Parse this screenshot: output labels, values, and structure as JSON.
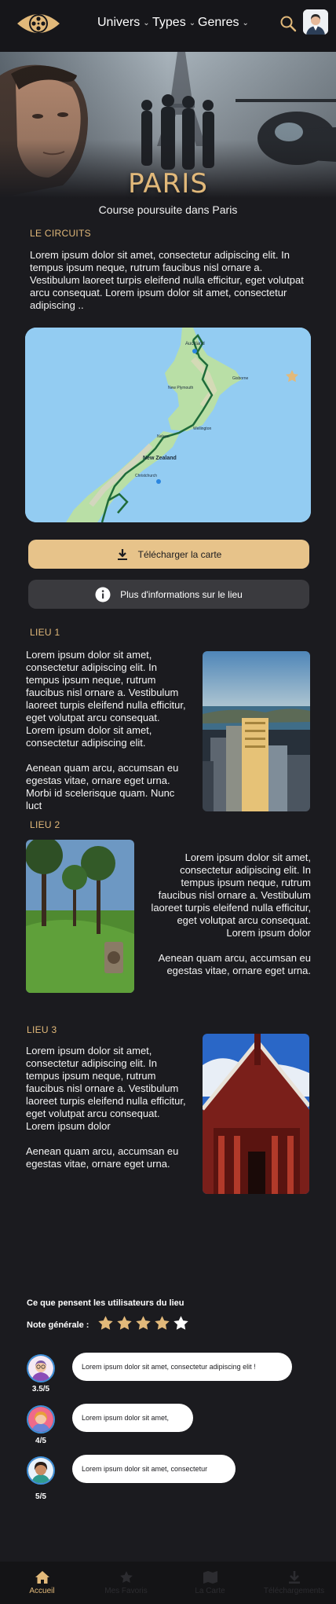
{
  "header": {
    "nav": [
      {
        "label": "Univers"
      },
      {
        "label": "Types"
      },
      {
        "label": "Genres"
      }
    ]
  },
  "hero": {
    "title": "PARIS",
    "subtitle": "Course poursuite dans Paris"
  },
  "circuit": {
    "label": "LE CIRCUITS",
    "text": "Lorem ipsum dolor sit amet, consectetur adipiscing elit. In tempus ipsum neque, rutrum faucibus nisl ornare a. Vestibulum laoreet turpis eleifend nulla efficitur, eget volutpat arcu consequat. Lorem ipsum dolor sit amet, consectetur adipiscing ..",
    "map_labels": [
      "Auckland",
      "New Plymouth",
      "Gisborne",
      "Nelson",
      "Wellington",
      "New Zealand",
      "Christchurch"
    ]
  },
  "buttons": {
    "download": "Télécharger la carte",
    "info": "Plus d'informations sur le lieu"
  },
  "lieux": [
    {
      "label": "LIEU  1",
      "p1": "Lorem ipsum dolor sit amet, consectetur adipiscing elit. In tempus ipsum neque, rutrum faucibus nisl ornare a. Vestibulum laoreet turpis eleifend nulla efficitur, eget volutpat arcu consequat. Lorem ipsum dolor sit amet, consectetur adipiscing elit.",
      "p2": "Aenean quam arcu, accumsan eu egestas vitae, ornare eget urna. Morbi id scelerisque quam. Nunc luct"
    },
    {
      "label": "LIEU 2",
      "p1": "Lorem ipsum dolor sit amet, consectetur adipiscing elit. In tempus ipsum neque, rutrum faucibus nisl ornare a. Vestibulum laoreet turpis eleifend nulla efficitur, eget volutpat arcu consequat. Lorem ipsum dolor",
      "p2": "Aenean quam arcu, accumsan eu egestas vitae, ornare eget urna."
    },
    {
      "label": "LIEU 3",
      "p1": "Lorem ipsum dolor sit amet, consectetur adipiscing elit. In tempus ipsum neque, rutrum faucibus nisl ornare a. Vestibulum laoreet turpis eleifend nulla efficitur, eget volutpat arcu consequat. Lorem ipsum dolor",
      "p2": "Aenean quam arcu, accumsan eu egestas vitae, ornare eget urna."
    }
  ],
  "reviews": {
    "title": "Ce que pensent les utilisateurs du lieu",
    "note_label": "Note générale :",
    "overall_rating": 4,
    "overall_max": 5,
    "items": [
      {
        "score": "3.5/5",
        "text": "Lorem ipsum dolor sit amet, consectetur adipiscing elit !"
      },
      {
        "score": "4/5",
        "text": "Lorem ipsum dolor sit amet,"
      },
      {
        "score": "5/5",
        "text": "Lorem ipsum dolor sit amet, consectetur"
      }
    ]
  },
  "tabbar": [
    {
      "label": "Accueil",
      "icon": "home-icon",
      "active": true
    },
    {
      "label": "Mes Favoris",
      "icon": "star-icon",
      "active": false
    },
    {
      "label": "La Carte",
      "icon": "map-icon",
      "active": false
    },
    {
      "label": "Téléchargements",
      "icon": "download-icon",
      "active": false
    }
  ],
  "colors": {
    "accent": "#e2b97a",
    "background": "#1b1b1f",
    "button_gold": "#e7c38a"
  }
}
